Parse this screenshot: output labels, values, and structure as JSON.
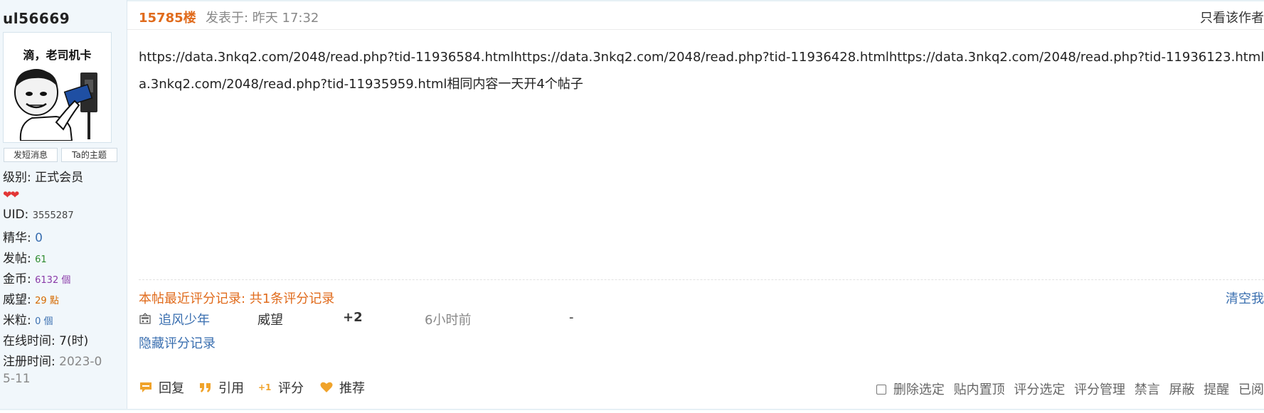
{
  "user": {
    "name": "ul56669",
    "avatar_caption": "滴，老司机卡",
    "send_message": "发短消息",
    "their_topics": "Ta的主题",
    "level_label": "级别:",
    "level_value": "正式会员",
    "hearts": "❤❤",
    "uid_label": "UID:",
    "uid_value": "3555287",
    "essence_label": "精华:",
    "essence_value": "0",
    "posts_label": "发帖:",
    "posts_value": "61",
    "gold_label": "金币:",
    "gold_value": "6132 個",
    "prestige_label": "威望:",
    "prestige_value": "29 點",
    "rice_label": "米粒:",
    "rice_value": "0 個",
    "online_label": "在线时间:",
    "online_value": "7(时)",
    "reg_label": "注册时间:",
    "reg_value_1": "2023-0",
    "reg_value_2": "5-11"
  },
  "post": {
    "floor": "15785楼",
    "posted_at": "发表于: 昨天 17:32",
    "only_author": "只看该作者",
    "line1": "https://data.3nkq2.com/2048/read.php?tid-11936584.htmlhttps://data.3nkq2.com/2048/read.php?tid-11936428.htmlhttps://data.3nkq2.com/2048/read.php?tid-11936123.html",
    "line2": "a.3nkq2.com/2048/read.php?tid-11935959.html相同内容一天开4个帖子"
  },
  "rating": {
    "title": "本帖最近评分记录: 共1条评分记录",
    "clear": "清空我",
    "user": "追风少年",
    "category": "威望",
    "points": "+2",
    "time": "6小时前",
    "reason": "-",
    "hide": "隐藏评分记录"
  },
  "actions": {
    "reply": "回复",
    "quote": "引用",
    "rate": "评分",
    "recommend": "推荐"
  },
  "admin": {
    "delete": "删除选定",
    "pin": "贴内置顶",
    "rate_sel": "评分选定",
    "rate_mgmt": "评分管理",
    "ban": "禁言",
    "block": "屏蔽",
    "remind": "提醒",
    "read": "已阅"
  },
  "colors": {
    "accent_orange": "#e06b1c",
    "link_blue": "#3a6fb0",
    "sidebar_bg": "#f1f7fb"
  }
}
